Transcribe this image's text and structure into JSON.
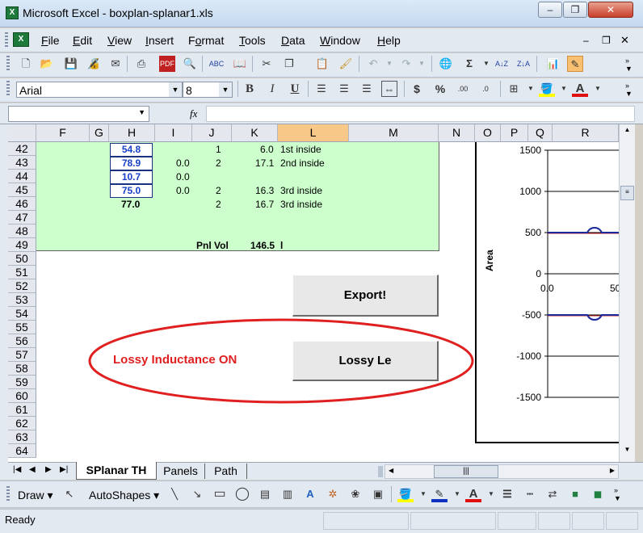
{
  "window": {
    "title": "Microsoft Excel - boxplan-splanar1.xls",
    "minimize": "–",
    "restore": "❐",
    "close": "✕"
  },
  "menu": {
    "items": [
      {
        "accel": "F",
        "rest": "ile"
      },
      {
        "accel": "E",
        "rest": "dit"
      },
      {
        "accel": "V",
        "rest": "iew"
      },
      {
        "accel": "I",
        "rest": "nsert"
      },
      {
        "accel": "",
        "pre": "F",
        "accel2": "o",
        "rest": "rmat"
      },
      {
        "accel": "T",
        "rest": "ools"
      },
      {
        "accel": "D",
        "rest": "ata"
      },
      {
        "accel": "W",
        "rest": "indow"
      },
      {
        "accel": "H",
        "rest": "elp"
      }
    ],
    "doc_close": "✕"
  },
  "format_bar": {
    "font": "Arial",
    "size": "8",
    "bold": "B",
    "italic": "I",
    "underline": "U",
    "currency": "$",
    "percent": "%"
  },
  "formula_bar": {
    "name_box": "",
    "fx": "fx",
    "formula": ""
  },
  "columns": [
    "F",
    "G",
    "H",
    "I",
    "J",
    "K",
    "L",
    "M",
    "N",
    "O",
    "P",
    "Q",
    "R"
  ],
  "selected_column": "L",
  "rows": [
    "42",
    "43",
    "44",
    "45",
    "46",
    "47",
    "48",
    "49",
    "50",
    "51",
    "52",
    "53",
    "54",
    "55",
    "56",
    "57",
    "58",
    "59",
    "60",
    "61",
    "62",
    "63",
    "64"
  ],
  "cells": {
    "h42": "54.8",
    "j42": "1",
    "k42": "6.0",
    "l42": "1st inside",
    "h43": "78.9",
    "i43": "0.0",
    "j43": "2",
    "k43": "17.1",
    "l43": "2nd inside",
    "h44": "10.7",
    "i44": "0.0",
    "h45": "75.0",
    "i45": "0.0",
    "j45": "2",
    "k45": "16.3",
    "l45": "3rd inside",
    "h46": "77.0",
    "j46": "2",
    "k46": "16.7",
    "l46": "3rd inside",
    "pnl_vol_label": "Pnl Vol",
    "pnl_vol_value": "146.5",
    "pnl_vol_unit": "l"
  },
  "buttons": {
    "export": "Export!",
    "lossy": "Lossy Le"
  },
  "lossy_status": "Lossy Inductance ON",
  "chart_data": {
    "type": "line",
    "ylabel": "Area",
    "yticks": [
      "1500",
      "1000",
      "500",
      "0",
      "-500",
      "-1000",
      "-1500"
    ],
    "xticks": [
      "0.0",
      "50"
    ],
    "ylim": [
      -1500,
      1500
    ],
    "series": [
      {
        "values_hint": "upper boundary near 500 with small bump",
        "y": 500
      },
      {
        "values_hint": "lower boundary near -500 with small bump",
        "y": -500
      }
    ],
    "colors": {
      "upper": "#1a2a9a",
      "lower": "#1a2a9a",
      "redline": "#c82020"
    }
  },
  "tabs": [
    "SPlanar TH",
    "Panels",
    "Path"
  ],
  "drawing": {
    "draw": "Draw",
    "autoshapes": "AutoShapes"
  },
  "status": {
    "text": "Ready"
  },
  "colors": {
    "green_fill": "#ccffcc",
    "ellipse": "#e02020",
    "lossy_text": "#e02020"
  }
}
